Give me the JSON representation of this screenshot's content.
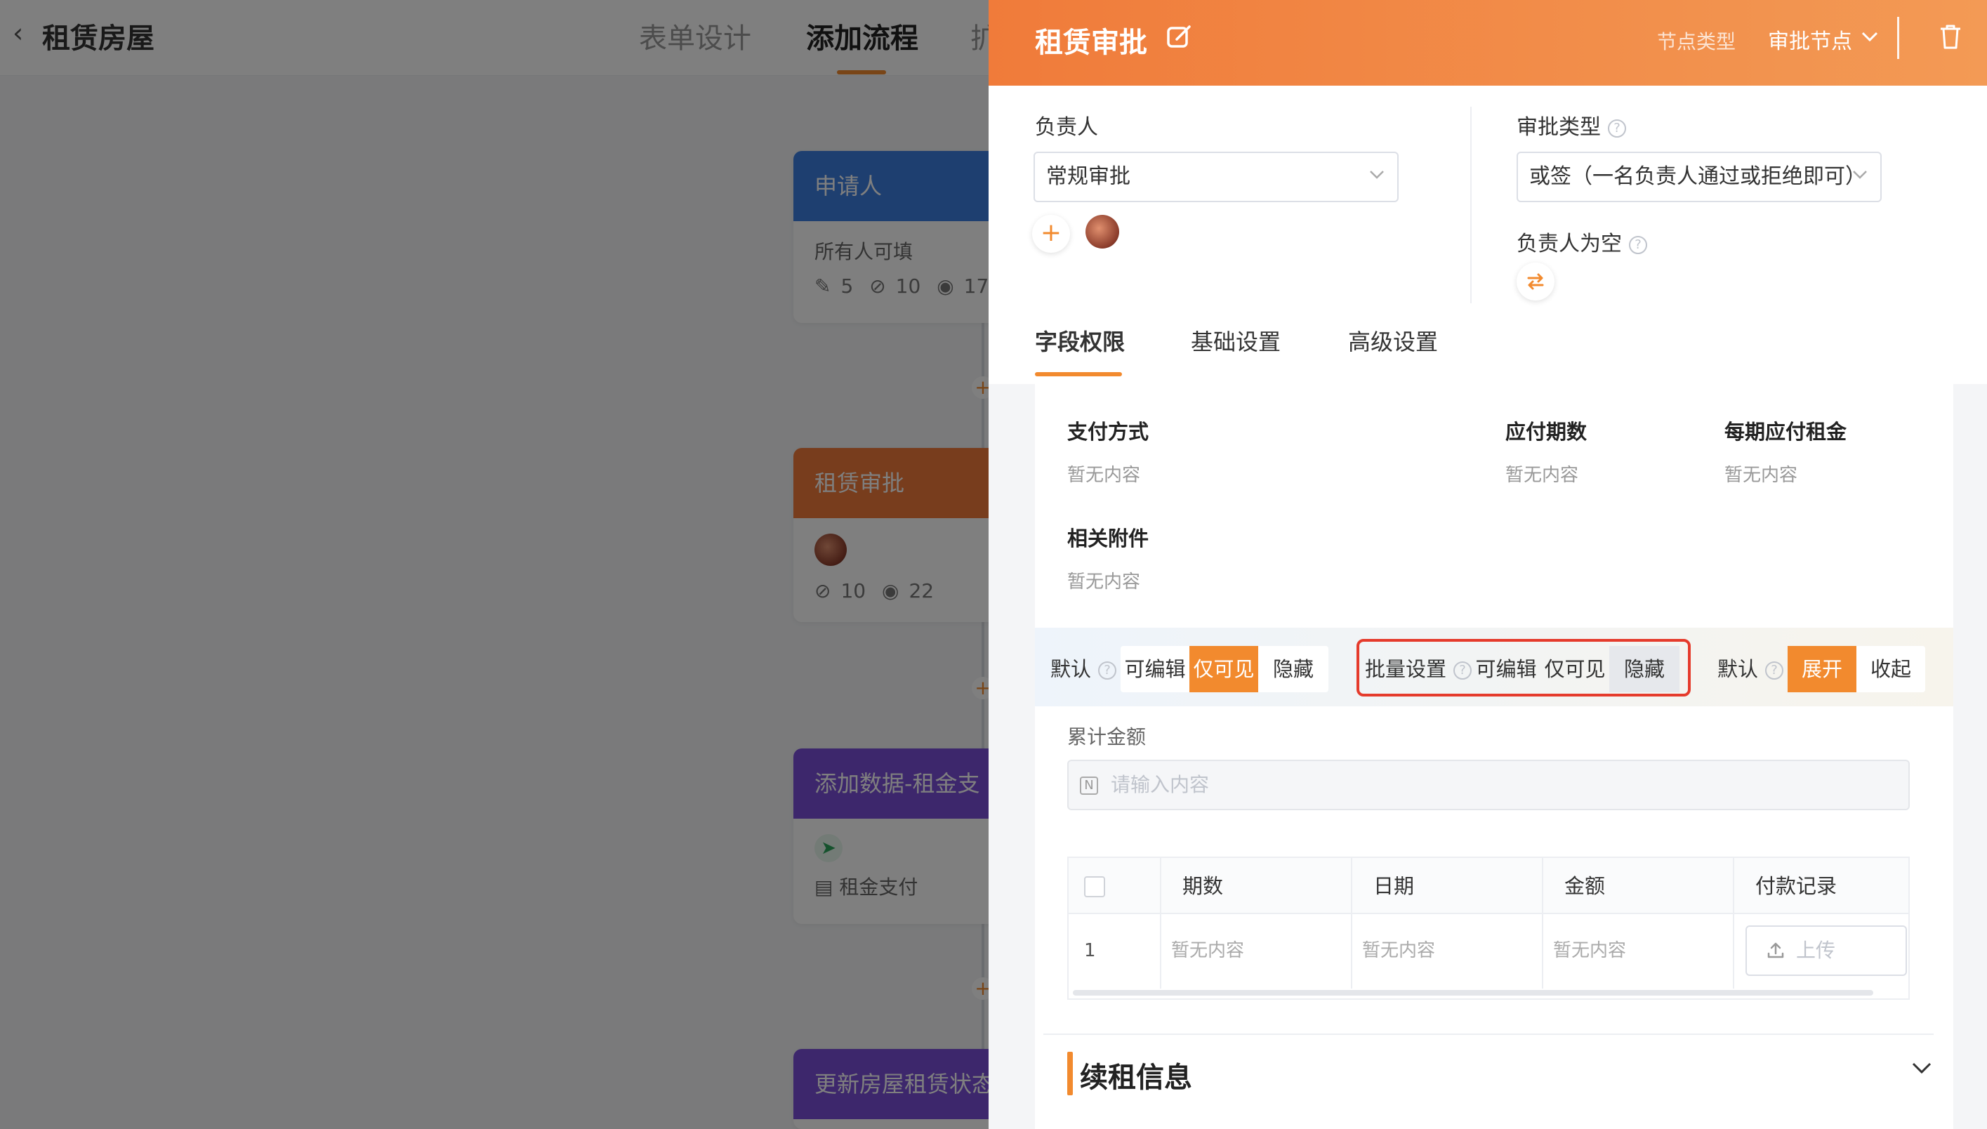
{
  "app": {
    "title": "租赁房屋",
    "tabs": [
      {
        "label": "表单设计"
      },
      {
        "label": "添加流程"
      },
      {
        "label": "扩"
      }
    ]
  },
  "flow": {
    "nodes": [
      {
        "title": "申请人",
        "subtitle": "所有人可填",
        "stats": [
          "5",
          "10",
          "17"
        ],
        "color": "#3d7fe0"
      },
      {
        "title": "租赁审批",
        "stats": [
          "10",
          "22"
        ],
        "color": "#f07b3a"
      },
      {
        "title": "添加数据-租金支",
        "subtitle": "租金支付",
        "color": "#7b4fd8"
      },
      {
        "title": "更新房屋租赁状态",
        "color": "#7b4fd8"
      }
    ],
    "plus": "+"
  },
  "drawer": {
    "title": "租赁审批",
    "node_type_label": "节点类型",
    "node_type": "审批节点",
    "assignee_label": "负责人",
    "assignee_select": "常规审批",
    "approval_type_label": "审批类型",
    "approval_type_select": "或签（一名负责人通过或拒绝即可）",
    "empty_assignee_label": "负责人为空",
    "tabs": [
      {
        "label": "字段权限"
      },
      {
        "label": "基础设置"
      },
      {
        "label": "高级设置"
      }
    ]
  },
  "form": {
    "fields": [
      {
        "label": "支付方式",
        "value": "暂无内容"
      },
      {
        "label": "应付期数",
        "value": "暂无内容"
      },
      {
        "label": "每期应付租金",
        "value": "暂无内容"
      },
      {
        "label": "相关附件",
        "value": "暂无内容"
      }
    ],
    "perm_default": {
      "label": "默认",
      "options": [
        "可编辑",
        "仅可见",
        "隐藏"
      ],
      "selected": "仅可见"
    },
    "perm_batch": {
      "label": "批量设置",
      "options": [
        "可编辑",
        "仅可见",
        "隐藏"
      ],
      "selected": "隐藏"
    },
    "expand_default": {
      "label": "默认",
      "options": [
        "展开",
        "收起"
      ],
      "selected": "展开"
    },
    "cumulative": {
      "label": "累计金额",
      "placeholder": "请输入内容"
    },
    "table": {
      "columns": [
        "期数",
        "日期",
        "金额",
        "付款记录"
      ],
      "rows": [
        {
          "index": "1",
          "cells": [
            "暂无内容",
            "暂无内容",
            "暂无内容"
          ],
          "upload": "上传"
        }
      ]
    },
    "section_title": "续租信息"
  },
  "colors": {
    "accent": "#f28a2e",
    "highlight": "#e53b2c"
  }
}
